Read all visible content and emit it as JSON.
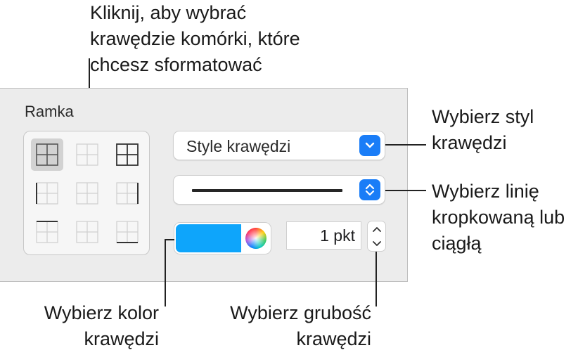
{
  "callouts": {
    "select_edges": [
      "Kliknij, aby wybrać",
      "krawędzie komórki, które",
      "chcesz sformatować"
    ],
    "select_style": [
      "Wybierz styl",
      "krawędzi"
    ],
    "select_line": [
      "Wybierz linię",
      "kropkowaną lub",
      "ciągłą"
    ],
    "select_color": [
      "Wybierz kolor",
      "krawędzi"
    ],
    "select_thickness": [
      "Wybierz grubość",
      "krawędzi"
    ]
  },
  "panel": {
    "section_title": "Ramka",
    "border_buttons": [
      {
        "name": "all-borders-icon",
        "selected": true
      },
      {
        "name": "inner-borders-icon",
        "selected": false
      },
      {
        "name": "outer-and-inner-borders-icon",
        "selected": false
      },
      {
        "name": "left-border-icon",
        "selected": false
      },
      {
        "name": "vertical-inner-border-icon",
        "selected": false
      },
      {
        "name": "right-border-icon",
        "selected": false
      },
      {
        "name": "top-border-icon",
        "selected": false
      },
      {
        "name": "horizontal-inner-border-icon",
        "selected": false
      },
      {
        "name": "bottom-border-icon",
        "selected": false
      }
    ],
    "style_dropdown": {
      "label": "Style krawędzi"
    },
    "thickness": {
      "value": "1 pkt"
    },
    "colors": {
      "border_color": "#0ea5fb",
      "accent": "#1a7df7"
    }
  }
}
